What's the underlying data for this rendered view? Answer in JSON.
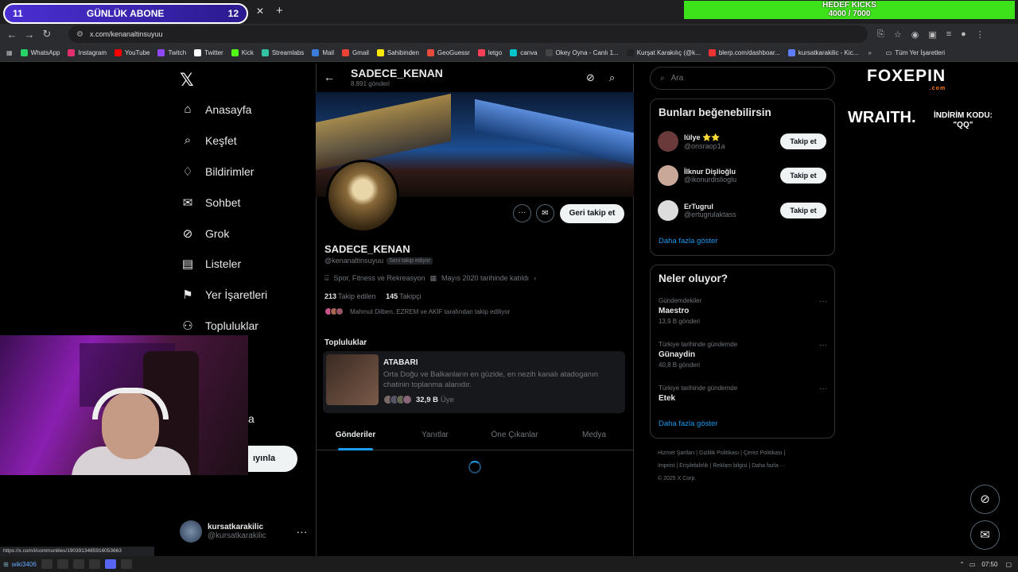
{
  "overlay": {
    "abone_left": "11",
    "abone_title": "GÜNLÜK ABONE",
    "abone_right": "12",
    "kicks_title": "HEDEF KICKS",
    "kicks_value": "4000 / 7000",
    "foxepin": "FOXEPIN",
    "foxepin_tld": ".com",
    "wraith": "WRAITH.",
    "code_label": "İNDİRİM KODU:",
    "code_value": "\"QQ\""
  },
  "browser": {
    "url": "x.com/kenanaltinsuyuu",
    "bookmarks": [
      {
        "label": "WhatsApp",
        "color": "#25d366"
      },
      {
        "label": "Instagram",
        "color": "#e1306c"
      },
      {
        "label": "YouTube",
        "color": "#ff0000"
      },
      {
        "label": "Twitch",
        "color": "#9146ff"
      },
      {
        "label": "Twitter",
        "color": "#ffffff"
      },
      {
        "label": "Kick",
        "color": "#53fc18"
      },
      {
        "label": "Streamlabs",
        "color": "#31c3a2"
      },
      {
        "label": "Mail",
        "color": "#3d7bd9"
      },
      {
        "label": "Gmail",
        "color": "#ea4335"
      },
      {
        "label": "Sahibinden",
        "color": "#ffe800"
      },
      {
        "label": "GeoGuessr",
        "color": "#e84b3c"
      },
      {
        "label": "letgo",
        "color": "#ff3f55"
      },
      {
        "label": "canva",
        "color": "#00c4cc"
      },
      {
        "label": "Okey Oyna - Canlı 1...",
        "color": "#444444"
      },
      {
        "label": "Kurşat Karakılıç (@k...",
        "color": "#222222"
      },
      {
        "label": "blerp.com/dashboar...",
        "color": "#e33"
      },
      {
        "label": "kursatkarakilic - Kic...",
        "color": "#5d7fff"
      }
    ],
    "all_bookmarks": "Tüm Yer İşaretleri",
    "status_url": "https://x.com/i/communities/1903913485916053663"
  },
  "nav": {
    "items": [
      "Anasayfa",
      "Keşfet",
      "Bildirimler",
      "Sohbet",
      "Grok",
      "Listeler",
      "Yer İşaretleri",
      "Topluluklar"
    ],
    "partial_item": "a",
    "post_button": "ıyınla",
    "user_name": "kursatkarakilic",
    "user_handle": "@kursatkarakilic"
  },
  "profile": {
    "header_name": "SADECE_KENAN",
    "post_count": "8.891 gönderi",
    "name": "SADECE_KENAN",
    "handle": "@kenanaltinsuyuu",
    "follows_you": "Seni takip ediyor",
    "category": "Spor, Fitness ve Rekreasyon",
    "joined": "Mayıs 2020 tarihinde katıldı",
    "following_num": "213",
    "following_label": "Takip edilen",
    "followers_num": "145",
    "followers_label": "Takipçi",
    "followed_by": "Mahmut Dilben, EZREM ve AKİF tarafından takip ediliyor",
    "follow_button": "Geri takip et",
    "communities_title": "Topluluklar",
    "community": {
      "name": "ATABARI",
      "desc": "Orta Doğu ve Balkanların en güzide, en nezih kanalı atadoganın chatinin toplanma alanıdır.",
      "members_num": "32,9 B",
      "members_label": "Üye"
    },
    "tabs": [
      "Gönderiler",
      "Yanıtlar",
      "Öne Çıkanlar",
      "Medya"
    ]
  },
  "right": {
    "search_placeholder": "Ara",
    "sugg_title": "Bunları beğenebilirsin",
    "suggestions": [
      {
        "name": "lülye ⭐⭐",
        "handle": "@onsraop1a",
        "btn": "Takip et"
      },
      {
        "name": "İlknur Dişlioğlu",
        "handle": "@ikonurdislioglu",
        "btn": "Takip et"
      },
      {
        "name": "ErTugrul",
        "handle": "@ertugrulaktass",
        "btn": "Takip et"
      }
    ],
    "show_more": "Daha fazla göster",
    "trend_title": "Neler oluyor?",
    "trends": [
      {
        "context": "Gündemdekiler",
        "name": "Maestro",
        "count": "13,9 B gönderi"
      },
      {
        "context": "Türkiye tarihinde gündemde",
        "name": "Günaydin",
        "count": "40,8 B gönderi"
      },
      {
        "context": "Türkiye tarihinde gündemde",
        "name": "Etek",
        "count": ""
      }
    ],
    "footer_line1": "Hizmet Şartları | Gizlilik Politikası | Çerez Politikası |",
    "footer_line2": "Imprint | Erişilebilirlik | Reklam bilgisi | Daha fazla ···",
    "footer_line3": "© 2025 X Corp."
  },
  "taskbar": {
    "time": "07:50",
    "left_text": "wiki3406"
  }
}
